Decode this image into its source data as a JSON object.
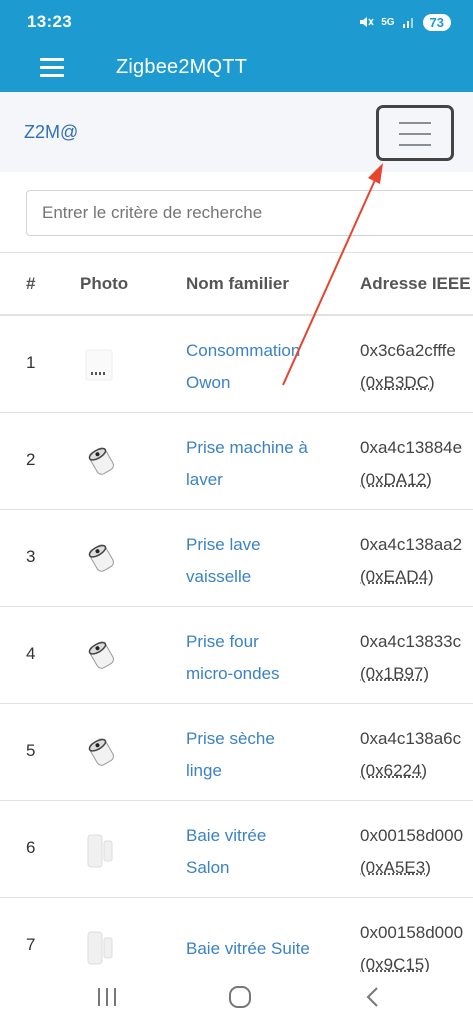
{
  "status": {
    "time": "13:23",
    "network": "5G",
    "battery": "73"
  },
  "app_bar": {
    "title": "Zigbee2MQTT"
  },
  "header": {
    "brand": "Z2M@"
  },
  "search": {
    "placeholder": "Entrer le critère de recherche"
  },
  "table": {
    "columns": [
      "#",
      "Photo",
      "Nom familier",
      "Adresse IEEE"
    ],
    "rows": [
      {
        "num": "1",
        "name_line1": "Consommation",
        "name_line2": "Owon",
        "ieee": "0x3c6a2cfffe",
        "nwk": "(0xB3DC)",
        "photo": "energy-meter"
      },
      {
        "num": "2",
        "name_line1": "Prise machine à",
        "name_line2": "laver",
        "ieee": "0xa4c13884e",
        "nwk": "(0xDA12)",
        "photo": "smart-plug"
      },
      {
        "num": "3",
        "name_line1": "Prise lave",
        "name_line2": "vaisselle",
        "ieee": "0xa4c138aa2",
        "nwk": "(0xEAD4)",
        "photo": "smart-plug"
      },
      {
        "num": "4",
        "name_line1": "Prise four",
        "name_line2": "micro-ondes",
        "ieee": "0xa4c13833c",
        "nwk": "(0x1B97)",
        "photo": "smart-plug"
      },
      {
        "num": "5",
        "name_line1": "Prise sèche",
        "name_line2": "linge",
        "ieee": "0xa4c138a6c",
        "nwk": "(0x6224)",
        "photo": "smart-plug"
      },
      {
        "num": "6",
        "name_line1": "Baie vitrée",
        "name_line2": "Salon",
        "ieee": "0x00158d000",
        "nwk": "(0xA5E3)",
        "photo": "door-sensor"
      },
      {
        "num": "7",
        "name_line1": "Baie vitrée Suite",
        "name_line2": "",
        "ieee": "0x00158d000",
        "nwk": "(0x9C15)",
        "photo": "door-sensor"
      }
    ]
  },
  "annotation": {
    "color": "#e8432e"
  },
  "icons": {
    "menu": "hamburger-icon",
    "toggler": "navbar-toggler-icon",
    "nav_recent": "recent-apps-icon",
    "nav_home": "home-icon",
    "nav_back": "back-icon"
  },
  "colors": {
    "primary": "#1d9bd1",
    "link": "#3b82c4",
    "brand": "#2f70b7"
  }
}
